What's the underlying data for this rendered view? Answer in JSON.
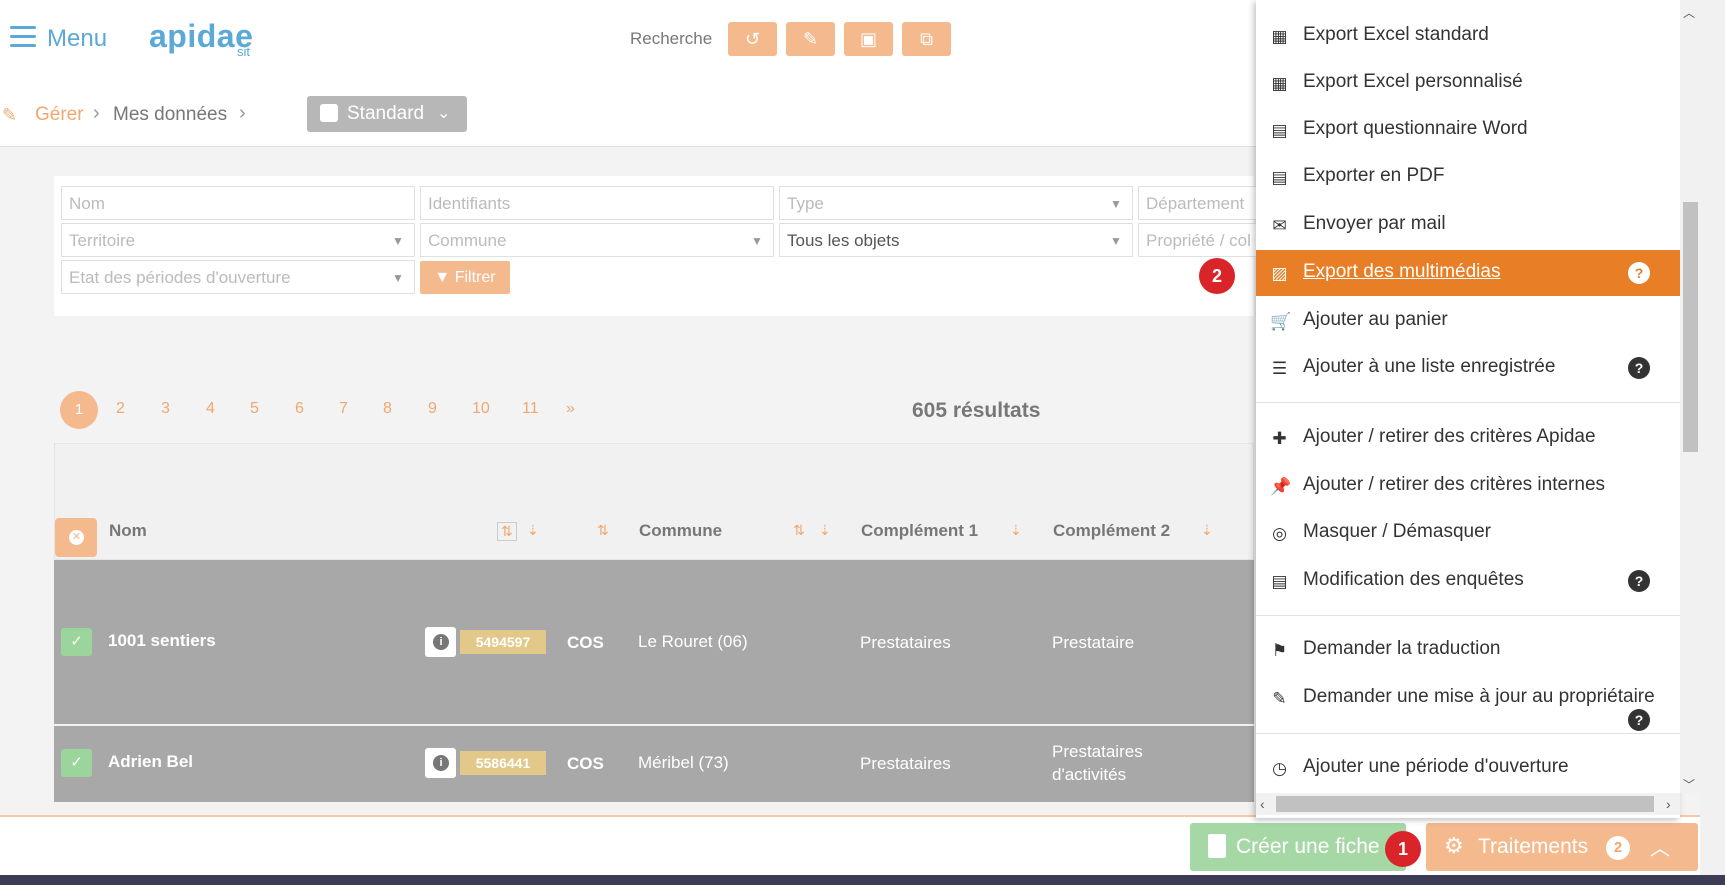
{
  "header": {
    "menu_label": "Menu",
    "logo": "apidae",
    "logo_sub": "sit",
    "search_label": "Recherche",
    "toolbar_icons": [
      "undo-icon",
      "pencil-icon",
      "save-icon",
      "copy-icon"
    ]
  },
  "breadcrumb": {
    "items": [
      "Gérer",
      "Mes données"
    ],
    "view_select": "Standard"
  },
  "filters": {
    "nom": "Nom",
    "identifiants": "Identifiants",
    "type": "Type",
    "departement": "Département",
    "territoire": "Territoire",
    "commune": "Commune",
    "objets": "Tous les objets",
    "propriete": "Propriété / col",
    "etat": "Etat des périodes d'ouverture",
    "filter_button": "Filtrer"
  },
  "pagination": {
    "pages": [
      "1",
      "2",
      "3",
      "4",
      "5",
      "6",
      "7",
      "8",
      "9",
      "10",
      "11",
      "»"
    ],
    "current": "1",
    "results": "605 résultats"
  },
  "table": {
    "columns": [
      "Nom",
      "Commune",
      "Complément 1",
      "Complément 2"
    ],
    "rows": [
      {
        "nom": "1001 sentiers",
        "id": "5494597",
        "type": "COS",
        "commune": "Le Rouret (06)",
        "c1": "Prestataires",
        "c2": "Prestataire",
        "c2b": ""
      },
      {
        "nom": "Adrien Bel",
        "id": "5586441",
        "type": "COS",
        "commune": "Méribel (73)",
        "c1": "Prestataires",
        "c2": "Prestataires",
        "c2b": "d'activités"
      }
    ]
  },
  "bottom": {
    "creer": "Créer une fiche",
    "traitements": "Traitements",
    "traitements_count": "2",
    "marker1": "1",
    "marker2": "2"
  },
  "menu": {
    "items": [
      {
        "label": "Export Excel standard",
        "icon": "table-icon"
      },
      {
        "label": "Export Excel personnalisé",
        "icon": "table-icon"
      },
      {
        "label": "Export questionnaire Word",
        "icon": "word-file-icon"
      },
      {
        "label": "Exporter en PDF",
        "icon": "pdf-file-icon"
      },
      {
        "label": "Envoyer par mail",
        "icon": "envelope-icon"
      },
      {
        "label": "Export des multimédias",
        "icon": "image-icon",
        "help": "?"
      },
      {
        "label": "Ajouter au panier",
        "icon": "cart-icon"
      },
      {
        "label": "Ajouter à une liste enregistrée",
        "icon": "list-icon",
        "help": "?"
      },
      {
        "label": "Ajouter / retirer des critères Apidae",
        "icon": "puzzle-icon"
      },
      {
        "label": "Ajouter / retirer des critères internes",
        "icon": "pin-icon"
      },
      {
        "label": "Masquer / Démasquer",
        "icon": "eye-slash-icon"
      },
      {
        "label": "Modification des enquêtes",
        "icon": "file-icon",
        "help": "?"
      },
      {
        "label": "Demander la traduction",
        "icon": "flag-icon"
      },
      {
        "label": "Demander une mise à jour au propriétaire",
        "icon": "edit-icon",
        "help": "?"
      },
      {
        "label": "Ajouter une période d'ouverture",
        "icon": "clock-icon"
      }
    ]
  },
  "colors": {
    "accent": "#e87e25",
    "orange_light": "#f5b98e",
    "blue": "#5aa9d6",
    "green": "#a6d8a6",
    "marker_red": "#d9242a"
  }
}
